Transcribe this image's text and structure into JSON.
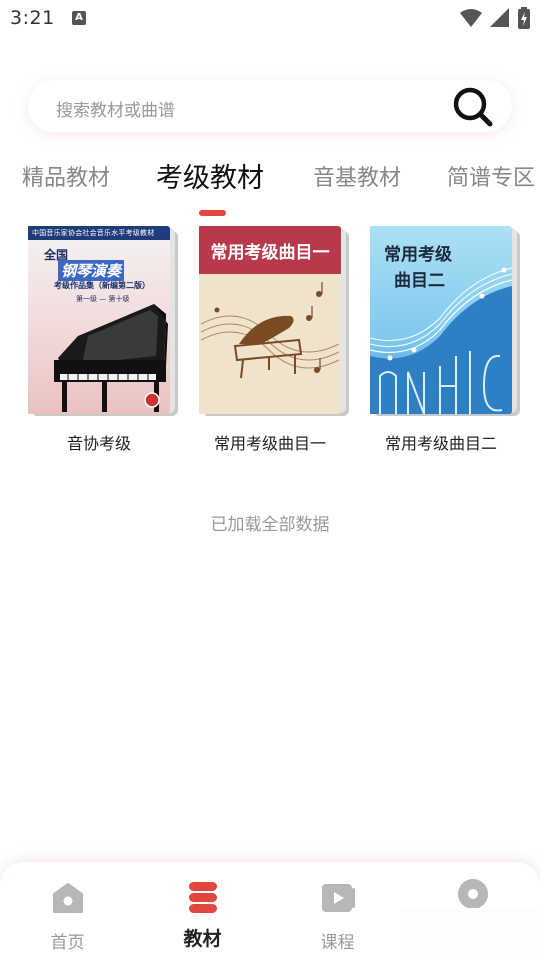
{
  "status_bar": {
    "time": "3:21",
    "notification_glyph": "A",
    "icons": [
      "wifi-icon",
      "signal-icon",
      "battery-charging-icon"
    ]
  },
  "search": {
    "placeholder": "搜索教材或曲谱",
    "icon": "search-icon"
  },
  "tabs": [
    {
      "label": "精品教材",
      "active": false
    },
    {
      "label": "考级教材",
      "active": true
    },
    {
      "label": "音基教材",
      "active": false
    },
    {
      "label": "简谱专区",
      "active": false
    }
  ],
  "books": [
    {
      "title": "音协考级",
      "cover": {
        "band": "中国音乐家协会社会音乐水平考级教材",
        "line1": "全国",
        "line2": "钢琴演奏",
        "line3": "考级作品集（新编第二版）",
        "line4": "第一级 — 第十级"
      }
    },
    {
      "title": "常用考级曲目一",
      "cover": {
        "heading": "常用考级曲目一"
      }
    },
    {
      "title": "常用考级曲目二",
      "cover": {
        "heading_line1": "常用考级",
        "heading_line2": "曲目二"
      }
    }
  ],
  "status_text": "已加载全部数据",
  "bottom_nav": [
    {
      "label": "首页",
      "icon": "home-icon",
      "active": false
    },
    {
      "label": "教材",
      "icon": "textbook-icon",
      "active": true
    },
    {
      "label": "课程",
      "icon": "video-course-icon",
      "active": false
    },
    {
      "label": "",
      "icon": "profile-icon",
      "active": false
    }
  ],
  "colors": {
    "accent": "#e2463f",
    "active_text": "#111111",
    "inactive_text": "#888888"
  }
}
